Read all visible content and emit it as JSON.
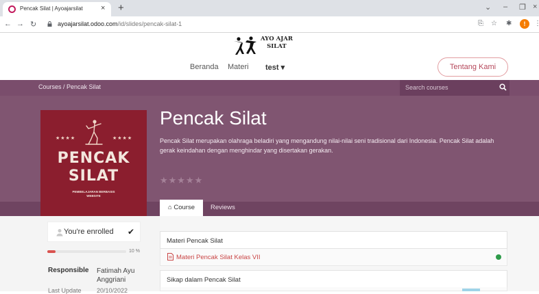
{
  "browser": {
    "tab_title": "Pencak Silat | Ayoajarsilat",
    "url_host": "ayoajarsilat.odoo.com",
    "url_path": "/id/slides/pencak-silat-1",
    "profile_initial": "!"
  },
  "site": {
    "logo_line1": "AYO AJAR",
    "logo_line2": "SILAT",
    "nav": [
      "Beranda",
      "Materi",
      "test ▾"
    ],
    "cta": "Tentang Kami"
  },
  "breadcrumb": {
    "text": "Courses  /  Pencak Silat",
    "search_placeholder": "Search courses"
  },
  "course": {
    "cover_stars": "★★★★",
    "cover_title_1": "PENCAK",
    "cover_title_2": "SILAT",
    "cover_subtitle_1": "PEMBELAJARAN BERBASIS",
    "cover_subtitle_2": "WEBSITE",
    "title": "Pencak Silat",
    "description": "Pencak Silat merupakan olahraga beladiri yang mengandung nilai-nilai seni tradisional dari Indonesia. Pencak Silat adalah gerak keindahan dengan menghindar yang disertakan gerakan.",
    "rating": 0,
    "rating_stars": "★★★★★",
    "tabs": [
      "Course",
      "Reviews"
    ]
  },
  "sidebar": {
    "enrolled_label": "You're enrolled",
    "progress_value": 0.1,
    "progress_label": "10 %",
    "responsible_label": "Responsible",
    "responsible_name": "Fatimah Ayu Anggriani",
    "last_update_label": "Last Update",
    "last_update_value": "20/10/2022"
  },
  "content": {
    "sections": [
      {
        "title": "Materi Pencak Silat",
        "slides": [
          {
            "title": "Materi Pencak Silat Kelas VII",
            "done": true
          }
        ]
      },
      {
        "title": "Sikap dalam Pencak Silat"
      }
    ]
  },
  "colors": {
    "hero": "#805571",
    "breadcrumb_bar": "#7a4d6c",
    "cover": "#8b1e2e",
    "accent": "#d9534f",
    "done": "#2e9b4a"
  }
}
